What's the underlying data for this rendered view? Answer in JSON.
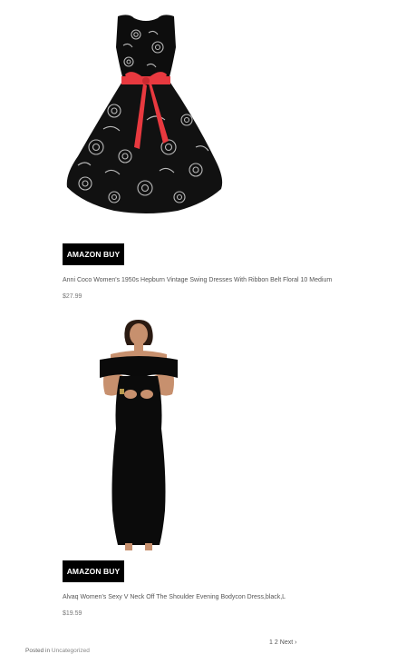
{
  "products": [
    {
      "image_alt": "black floral swing dress with red ribbon belt",
      "button_label": "AMAZON BUY",
      "title": "Anni Coco Women's 1950s Hepburn Vintage Swing Dresses With Ribbon Belt Floral 10 Medium",
      "price": "$27.99"
    },
    {
      "image_alt": "black off the shoulder bodycon dress",
      "button_label": "AMAZON BUY",
      "title": "Alvaq Women's Sexy V Neck Off The Shoulder Evening Bodycon Dress,black,L",
      "price": "$19.59"
    }
  ],
  "pagination": {
    "page1": "1",
    "page2": "2",
    "next": "Next ›"
  },
  "post_meta": {
    "prefix": "Posted in",
    "category": "Uncategorized"
  },
  "colors": {
    "button_bg": "#000000",
    "button_text": "#ffffff",
    "ribbon": "#e8393f"
  }
}
